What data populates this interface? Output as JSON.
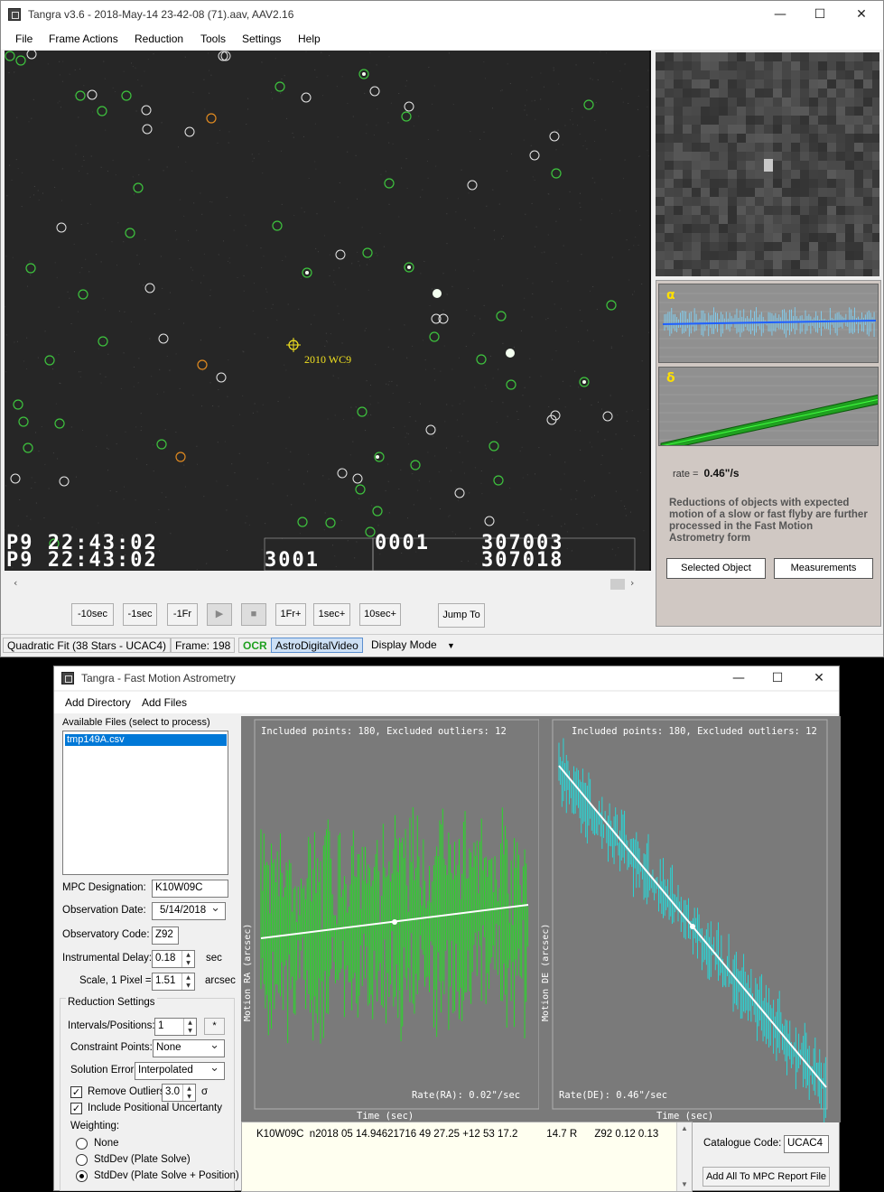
{
  "main_window": {
    "title": "Tangra v3.6 - 2018-May-14 23-42-08 (71).aav, AAV2.16",
    "menu": [
      "File",
      "Frame Actions",
      "Reduction",
      "Tools",
      "Settings",
      "Help"
    ],
    "video": {
      "target_label": "2010 WC9",
      "osd_line1_left": "P9 22:43:02",
      "osd_line1_mid": "0001",
      "osd_line1_right": "307003",
      "osd_line2_left": "P9 22:43:02",
      "osd_line2_mid": "3001",
      "osd_line2_right": "307018",
      "colors": {
        "background": "#262626",
        "identified_star": "#3ec43e",
        "unidentified_star": "#e8e8e8",
        "reference_star": "#e08a20",
        "target": "#f0e020"
      }
    },
    "right_panel": {
      "alpha_symbol": "α",
      "delta_symbol": "δ",
      "rate_label": "rate =",
      "rate_value": "0.46\"/s",
      "note": "Reductions of objects with expected motion of a slow or fast flyby are further processed in the Fast Motion Astrometry form",
      "selected_object_button": "Selected Object",
      "measurements_button": "Measurements"
    },
    "playback": [
      "-10sec",
      "-1sec",
      "-1Fr",
      "1Fr+",
      "1sec+",
      "10sec+"
    ],
    "jump_to": "Jump To",
    "status": {
      "fit": "Quadratic Fit (38 Stars - UCAC4)",
      "frame": "Frame: 198",
      "ocr": "OCR",
      "video_type": "AstroDigitalVideo",
      "display_mode": "Display Mode"
    }
  },
  "fma_window": {
    "title": "Tangra - Fast Motion Astrometry",
    "menu": [
      "Add Directory",
      "Add Files"
    ],
    "files_label": "Available Files (select to process)",
    "files": [
      "tmp149A.csv"
    ],
    "mpc_designation_label": "MPC Designation:",
    "mpc_designation": "K10W09C",
    "observation_date_label": "Observation Date:",
    "observation_date": "5/14/2018",
    "observatory_code_label": "Observatory Code:",
    "observatory_code": "Z92",
    "instrumental_delay_label": "Instrumental Delay:",
    "instrumental_delay": "0.18",
    "instrumental_delay_unit": "sec",
    "scale_label": "Scale, 1 Pixel =",
    "scale": "1.51",
    "scale_unit": "arcsec",
    "reduction_settings_label": "Reduction Settings",
    "intervals_label": "Intervals/Positions:",
    "intervals": "1",
    "intervals_button": "*",
    "constraint_label": "Constraint Points:",
    "constraint": "None",
    "solution_error_label": "Solution Error:",
    "solution_error": "Interpolated",
    "remove_outliers_label": "Remove Outliers",
    "remove_outliers_value": "3.0",
    "sigma_symbol": "σ",
    "include_positional_label": "Include Positional Uncertanty",
    "weighting_label": "Weighting:",
    "weighting_options": [
      "None",
      "StdDev (Plate Solve)",
      "StdDev (Plate Solve + Position)"
    ],
    "weighting_selected": 2,
    "output_line": "K10W09C  n2018 05 14.94621716 49 27.25 +12 53 17.2          14.7 R      Z92 0.12 0.13",
    "catalogue_code_label": "Catalogue Code:",
    "catalogue_code": "UCAC4",
    "add_to_report_button": "Add All To MPC Report File",
    "plots": {
      "ra": {
        "header": "Included points: 180, Excluded outliers: 12",
        "ylabel": "Motion RA (arcsec)",
        "xlabel": "Time (sec)",
        "rate": "Rate(RA): 0.02\"/sec",
        "color": "#22e022"
      },
      "de": {
        "header": "Included points: 180, Excluded outliers: 12",
        "ylabel": "Motion DE (arcsec)",
        "xlabel": "Time (sec)",
        "rate": "Rate(DE): 0.46\"/sec",
        "color": "#22e0e0"
      }
    }
  }
}
